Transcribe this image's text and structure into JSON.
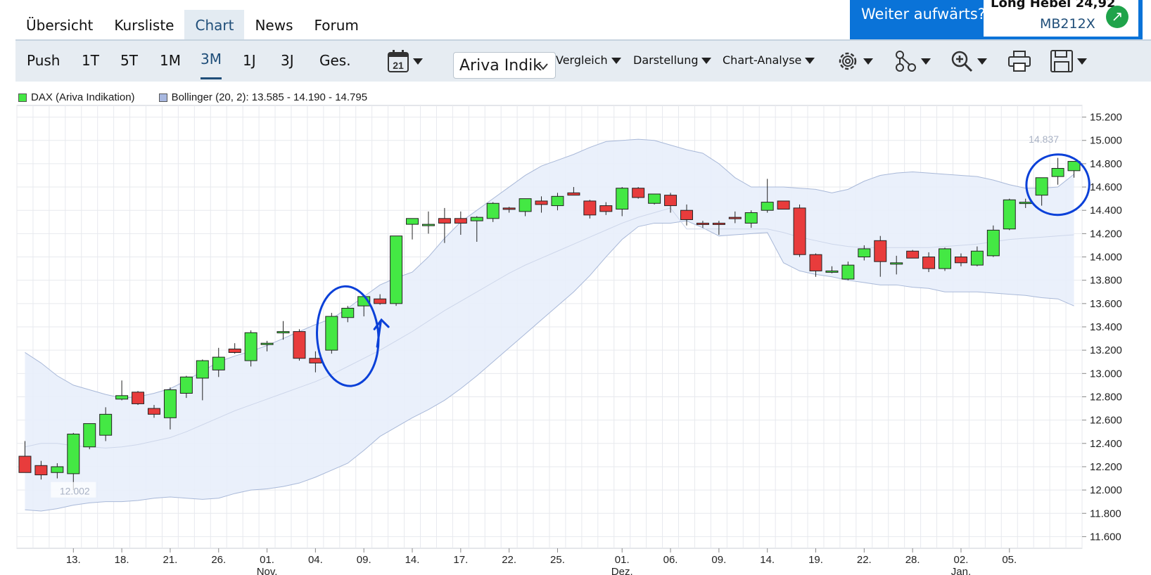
{
  "nav": {
    "tabs": [
      "Übersicht",
      "Kursliste",
      "Chart",
      "News",
      "Forum"
    ],
    "active": "Chart"
  },
  "promo": {
    "text": "Weiter aufwärts?",
    "title": "Long Hebel 24,92",
    "code": "MB212X"
  },
  "toolbar": {
    "ranges": [
      "Push",
      "1T",
      "5T",
      "1M",
      "3M",
      "1J",
      "3J",
      "Ges."
    ],
    "active_range": "3M",
    "calendar_day": "21",
    "source_select": "Ariva Indik",
    "menus": [
      "Vergleich",
      "Darstellung",
      "Chart-Analyse"
    ],
    "icons": [
      "settings-icon",
      "network-icon",
      "zoom-in-icon",
      "print-icon",
      "save-icon"
    ]
  },
  "legend": {
    "series1": "DAX (Ariva Indikation)",
    "series2": "Bollinger (20, 2): 13.585 - 14.190 - 14.795"
  },
  "colors": {
    "up": "#44e844",
    "down": "#e83c3c",
    "band_fill": "#e8eefb",
    "band_line": "#a8b8d8",
    "accent": "#1f4e79",
    "annotation": "#0a40d8"
  },
  "chart_data": {
    "type": "candlestick",
    "ylim": [
      11500,
      15300
    ],
    "y_ticks": [
      "15.200",
      "15.000",
      "14.800",
      "14.600",
      "14.400",
      "14.200",
      "14.000",
      "13.800",
      "13.600",
      "13.400",
      "13.200",
      "13.000",
      "12.800",
      "12.600",
      "12.400",
      "12.200",
      "12.000",
      "11.800",
      "11.600"
    ],
    "x_ticks": [
      {
        "i": 3.5,
        "label": "13."
      },
      {
        "i": 6.5,
        "label": "18."
      },
      {
        "i": 9.5,
        "label": "21."
      },
      {
        "i": 12.5,
        "label": "26."
      },
      {
        "i": 15.5,
        "label": "01.",
        "sub": "Nov."
      },
      {
        "i": 18.5,
        "label": "04."
      },
      {
        "i": 21.5,
        "label": "09."
      },
      {
        "i": 24.5,
        "label": "14."
      },
      {
        "i": 27.5,
        "label": "17."
      },
      {
        "i": 30.5,
        "label": "22."
      },
      {
        "i": 33.5,
        "label": "25."
      },
      {
        "i": 37.5,
        "label": "01.",
        "sub": "Dez."
      },
      {
        "i": 40.5,
        "label": "06."
      },
      {
        "i": 43.5,
        "label": "09."
      },
      {
        "i": 46.5,
        "label": "14."
      },
      {
        "i": 49.5,
        "label": "19."
      },
      {
        "i": 52.5,
        "label": "22."
      },
      {
        "i": 55.5,
        "label": "28."
      },
      {
        "i": 58.5,
        "label": "02.",
        "sub": "Jan."
      },
      {
        "i": 61.5,
        "label": "05."
      }
    ],
    "candles": [
      [
        12290,
        12420,
        12150,
        12150
      ],
      [
        12210,
        12250,
        12090,
        12130
      ],
      [
        12150,
        12230,
        12100,
        12200
      ],
      [
        12140,
        12490,
        12000,
        12480
      ],
      [
        12370,
        12570,
        12350,
        12570
      ],
      [
        12470,
        12710,
        12420,
        12650
      ],
      [
        12780,
        12940,
        12770,
        12810
      ],
      [
        12840,
        12850,
        12730,
        12740
      ],
      [
        12700,
        12730,
        12620,
        12650
      ],
      [
        12620,
        12880,
        12520,
        12860
      ],
      [
        12830,
        12980,
        12790,
        12970
      ],
      [
        12960,
        13120,
        12770,
        13110
      ],
      [
        13030,
        13220,
        12970,
        13140
      ],
      [
        13210,
        13260,
        13170,
        13180
      ],
      [
        13110,
        13370,
        13060,
        13350
      ],
      [
        13260,
        13280,
        13190,
        13260
      ],
      [
        13360,
        13450,
        13290,
        13360
      ],
      [
        13360,
        13380,
        13110,
        13130
      ],
      [
        13130,
        13190,
        13010,
        13090
      ],
      [
        13200,
        13520,
        13170,
        13490
      ],
      [
        13480,
        13580,
        13440,
        13560
      ],
      [
        13580,
        13660,
        13490,
        13660
      ],
      [
        13640,
        13680,
        13590,
        13600
      ],
      [
        13600,
        14180,
        13580,
        14180
      ],
      [
        14280,
        14330,
        14150,
        14330
      ],
      [
        14280,
        14390,
        14200,
        14280
      ],
      [
        14330,
        14420,
        14120,
        14290
      ],
      [
        14330,
        14390,
        14190,
        14290
      ],
      [
        14310,
        14350,
        14130,
        14340
      ],
      [
        14330,
        14470,
        14300,
        14460
      ],
      [
        14420,
        14430,
        14380,
        14410
      ],
      [
        14390,
        14500,
        14350,
        14500
      ],
      [
        14480,
        14520,
        14380,
        14450
      ],
      [
        14440,
        14550,
        14400,
        14520
      ],
      [
        14550,
        14600,
        14530,
        14530
      ],
      [
        14480,
        14490,
        14330,
        14360
      ],
      [
        14440,
        14470,
        14360,
        14390
      ],
      [
        14410,
        14600,
        14350,
        14590
      ],
      [
        14590,
        14600,
        14500,
        14510
      ],
      [
        14460,
        14540,
        14450,
        14540
      ],
      [
        14530,
        14550,
        14380,
        14440
      ],
      [
        14400,
        14450,
        14270,
        14320
      ],
      [
        14290,
        14310,
        14250,
        14280
      ],
      [
        14290,
        14310,
        14190,
        14280
      ],
      [
        14340,
        14390,
        14290,
        14330
      ],
      [
        14290,
        14400,
        14250,
        14380
      ],
      [
        14400,
        14670,
        14380,
        14470
      ],
      [
        14480,
        14480,
        14410,
        14410
      ],
      [
        14420,
        14450,
        14000,
        14020
      ],
      [
        14020,
        14030,
        13830,
        13880
      ],
      [
        13880,
        13920,
        13860,
        13880
      ],
      [
        13810,
        13960,
        13800,
        13930
      ],
      [
        14000,
        14100,
        13970,
        14070
      ],
      [
        14140,
        14180,
        13830,
        13960
      ],
      [
        13950,
        14010,
        13850,
        13950
      ],
      [
        14050,
        14060,
        13990,
        13990
      ],
      [
        14000,
        14040,
        13870,
        13900
      ],
      [
        13900,
        14080,
        13880,
        14070
      ],
      [
        14000,
        14030,
        13920,
        13950
      ],
      [
        13930,
        14090,
        13920,
        14050
      ],
      [
        14010,
        14270,
        14000,
        14230
      ],
      [
        14240,
        14500,
        14230,
        14490
      ],
      [
        14470,
        14500,
        14420,
        14470
      ],
      [
        14530,
        14610,
        14440,
        14680
      ],
      [
        14690,
        14850,
        14620,
        14760
      ],
      [
        14740,
        14820,
        14680,
        14820
      ]
    ],
    "bollinger": {
      "upper": [
        13180,
        13090,
        12980,
        12900,
        12860,
        12820,
        12790,
        12800,
        12830,
        12870,
        12940,
        13020,
        13100,
        13150,
        13190,
        13240,
        13300,
        13360,
        13420,
        13470,
        13560,
        13660,
        13760,
        13820,
        13870,
        14000,
        14160,
        14300,
        14400,
        14500,
        14600,
        14700,
        14780,
        14830,
        14880,
        14940,
        14990,
        15000,
        15010,
        15000,
        14960,
        14920,
        14890,
        14800,
        14680,
        14600,
        14600,
        14600,
        14590,
        14580,
        14550,
        14580,
        14650,
        14700,
        14720,
        14730,
        14720,
        14710,
        14700,
        14690,
        14660,
        14620,
        14590,
        14590,
        14600,
        14710
      ],
      "middle": [
        12370,
        12400,
        12400,
        12380,
        12370,
        12360,
        12370,
        12390,
        12420,
        12450,
        12500,
        12560,
        12620,
        12680,
        12730,
        12780,
        12830,
        12880,
        12930,
        12990,
        13060,
        13130,
        13200,
        13280,
        13360,
        13450,
        13540,
        13620,
        13700,
        13780,
        13860,
        13930,
        13990,
        14050,
        14110,
        14170,
        14230,
        14290,
        14340,
        14380,
        14420,
        14240,
        14240,
        14240,
        14240,
        14240,
        14240,
        14210,
        14170,
        14140,
        14110,
        14090,
        14080,
        14080,
        14080,
        14080,
        14080,
        14090,
        14100,
        14110,
        14130,
        14150,
        14160,
        14170,
        14180,
        14190
      ],
      "lower": [
        11830,
        11820,
        11840,
        11870,
        11890,
        11900,
        11900,
        11910,
        11930,
        11940,
        11930,
        11920,
        11930,
        11970,
        12000,
        12010,
        12030,
        12060,
        12110,
        12170,
        12230,
        12340,
        12460,
        12540,
        12620,
        12690,
        12770,
        12870,
        12980,
        13100,
        13220,
        13340,
        13460,
        13580,
        13700,
        13840,
        14000,
        14150,
        14260,
        14290,
        14290,
        14310,
        14250,
        14180,
        14190,
        14200,
        14210,
        13950,
        13880,
        13850,
        13830,
        13800,
        13780,
        13760,
        13760,
        13740,
        13730,
        13700,
        13700,
        13700,
        13690,
        13680,
        13670,
        13650,
        13640,
        13580
      ]
    },
    "annotations": [
      {
        "value": "14.837",
        "near": "last-high"
      },
      {
        "value": "12.002",
        "near": "low"
      }
    ]
  }
}
